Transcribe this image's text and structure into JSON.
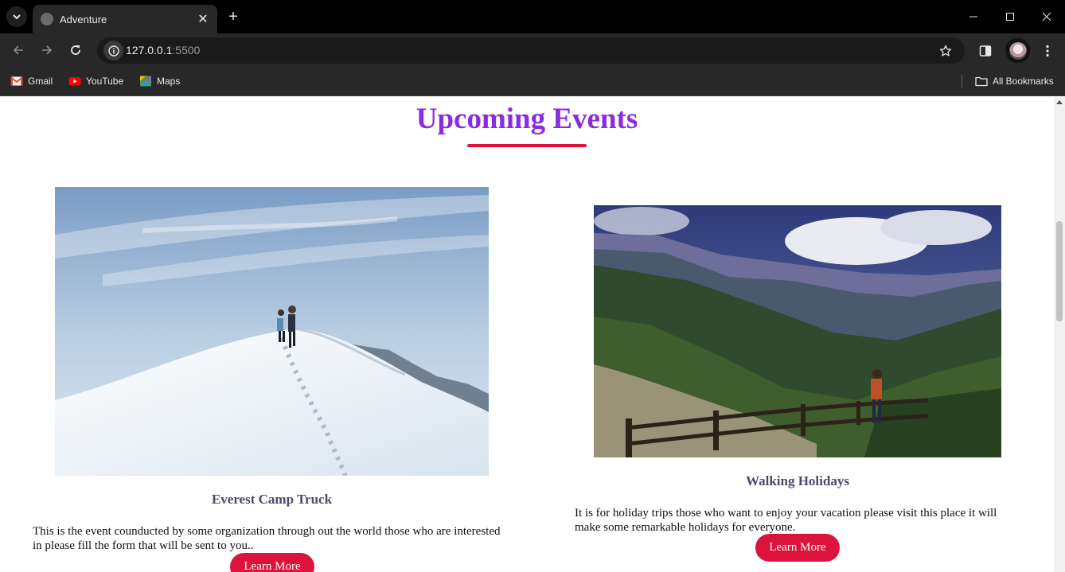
{
  "browser": {
    "tab": {
      "title": "Adventure",
      "close_glyph": "✕"
    },
    "new_tab_glyph": "+",
    "address": {
      "host": "127.0.0.1",
      "port": ":5500"
    },
    "bookmarks": [
      {
        "label": "Gmail",
        "icon": "gmail-icon"
      },
      {
        "label": "YouTube",
        "icon": "youtube-icon"
      },
      {
        "label": "Maps",
        "icon": "maps-icon"
      }
    ],
    "all_bookmarks_label": "All Bookmarks"
  },
  "page": {
    "section_title": "Upcoming Events",
    "events": [
      {
        "title": "Everest Camp Truck",
        "description": "This is the event counducted by some organization through out the world those who are interested in please fill the form that will be sent to you..",
        "button_label": "Learn More",
        "image": "snowy-mountain-hikers"
      },
      {
        "title": "Walking Holidays",
        "description": "It is for holiday trips those who want to enjoy your vacation please visit this place it will make some remarkable holidays for everyone.",
        "button_label": "Learn More",
        "image": "forest-valley-hiker"
      }
    ]
  },
  "colors": {
    "title": "#8a2be2",
    "accent": "#dc143c",
    "card_title": "#4a4a6a"
  }
}
